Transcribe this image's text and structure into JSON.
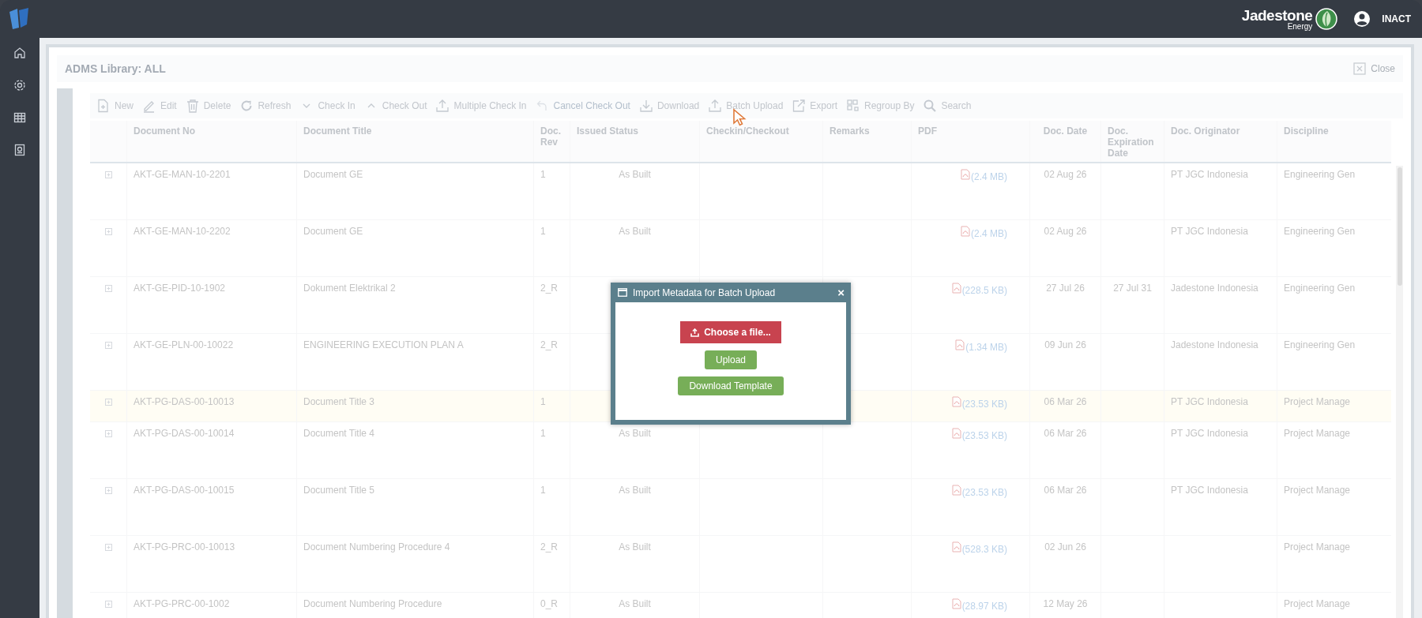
{
  "header": {
    "brand": {
      "name": "Jadestone",
      "sub": "Energy"
    },
    "user": "INACT"
  },
  "library": {
    "title": "ADMS Library: ALL",
    "close": "Close"
  },
  "toolbar": [
    {
      "label": "New",
      "kind": "new",
      "disabled": false
    },
    {
      "label": "Edit",
      "kind": "edit",
      "disabled": false
    },
    {
      "label": "Delete",
      "kind": "delete",
      "disabled": false
    },
    {
      "label": "Refresh",
      "kind": "refresh",
      "disabled": false
    },
    {
      "label": "Check In",
      "kind": "down",
      "disabled": false
    },
    {
      "label": "Check Out",
      "kind": "up",
      "disabled": false
    },
    {
      "label": "Multiple Check In",
      "kind": "upload",
      "disabled": false
    },
    {
      "label": "Cancel Check Out",
      "kind": "undo",
      "disabled": true
    },
    {
      "label": "Download",
      "kind": "download",
      "disabled": false
    },
    {
      "label": "Batch Upload",
      "kind": "upload",
      "disabled": false
    },
    {
      "label": "Export",
      "kind": "export",
      "disabled": false
    },
    {
      "label": "Regroup By",
      "kind": "regroup",
      "disabled": false
    },
    {
      "label": "Search",
      "kind": "search",
      "disabled": false
    }
  ],
  "table": {
    "columns": [
      "Document No",
      "Document Title",
      "Doc. Rev",
      "Issued Status",
      "Checkin/Checkout",
      "Remarks",
      "PDF",
      "Doc. Date",
      "Doc. Expiration Date",
      "Doc. Originator",
      "Discipline"
    ],
    "rows": [
      {
        "document_no": "AKT-GE-MAN-10-2201",
        "document_title": "Document GE",
        "doc_rev": "1",
        "issued_status": "As Built",
        "pdf": "(2.4 MB)",
        "doc_date": "02 Aug 26",
        "doc_originator": "PT JGC Indonesia",
        "discipline": "Engineering Gen",
        "selected": false
      },
      {
        "document_no": "AKT-GE-MAN-10-2202",
        "document_title": "Document GE",
        "doc_rev": "1",
        "issued_status": "As Built",
        "pdf": "(2.4 MB)",
        "doc_date": "02 Aug 26",
        "doc_originator": "PT JGC Indonesia",
        "discipline": "Engineering Gen",
        "selected": false
      },
      {
        "document_no": "AKT-GE-PID-10-1902",
        "document_title": "Dokument Elektrikal 2",
        "doc_rev": "2_R",
        "pdf": "(228.5 KB)",
        "doc_date": "27 Jul 26",
        "doc_expiration_date": "27 Jul 31",
        "doc_originator": "Jadestone Indonesia",
        "discipline": "Engineering Gen",
        "selected": false
      },
      {
        "document_no": "AKT-GE-PLN-00-10022",
        "document_title": "ENGINEERING EXECUTION PLAN A",
        "doc_rev": "2_R",
        "pdf": "(1.34 MB)",
        "doc_date": "09 Jun 26",
        "doc_originator": "Jadestone Indonesia",
        "discipline": "Engineering Gen",
        "selected": false
      },
      {
        "document_no": "AKT-PG-DAS-00-10013",
        "document_title": "Document Title 3",
        "doc_rev": "1",
        "pdf": "(23.53 KB)",
        "doc_date": "06 Mar 26",
        "doc_originator": "PT JGC Indonesia",
        "discipline": "Project Manage",
        "selected": true
      },
      {
        "document_no": "AKT-PG-DAS-00-10014",
        "document_title": "Document Title 4",
        "doc_rev": "1",
        "issued_status": "As Built",
        "pdf": "(23.53 KB)",
        "doc_date": "06 Mar 26",
        "doc_originator": "PT JGC Indonesia",
        "discipline": "Project Manage",
        "selected": false
      },
      {
        "document_no": "AKT-PG-DAS-00-10015",
        "document_title": "Document Title 5",
        "doc_rev": "1",
        "issued_status": "As Built",
        "pdf": "(23.53 KB)",
        "doc_date": "06 Mar 26",
        "doc_originator": "PT JGC Indonesia",
        "discipline": "Project Manage",
        "selected": false
      },
      {
        "document_no": "AKT-PG-PRC-00-10013",
        "document_title": "Document Numbering Procedure 4",
        "doc_rev": "2_R",
        "issued_status": "As Built",
        "pdf": "(528.3 KB)",
        "doc_date": "02 Jun 26",
        "discipline": "Project Manage",
        "selected": false
      },
      {
        "document_no": "AKT-PG-PRC-00-1002",
        "document_title": "Document Numbering Procedure",
        "doc_rev": "0_R",
        "issued_status": "As Built",
        "pdf": "(28.97 KB)",
        "doc_date": "12 May 26",
        "discipline": "Project Manage",
        "selected": false
      }
    ]
  },
  "dialog": {
    "title": "Import Metadata for Batch Upload",
    "close": "×",
    "buttons": [
      {
        "label": "Choose a file...",
        "kind": "choose"
      },
      {
        "label": "Upload",
        "kind": "action"
      },
      {
        "label": "Download Template",
        "kind": "action"
      }
    ]
  }
}
